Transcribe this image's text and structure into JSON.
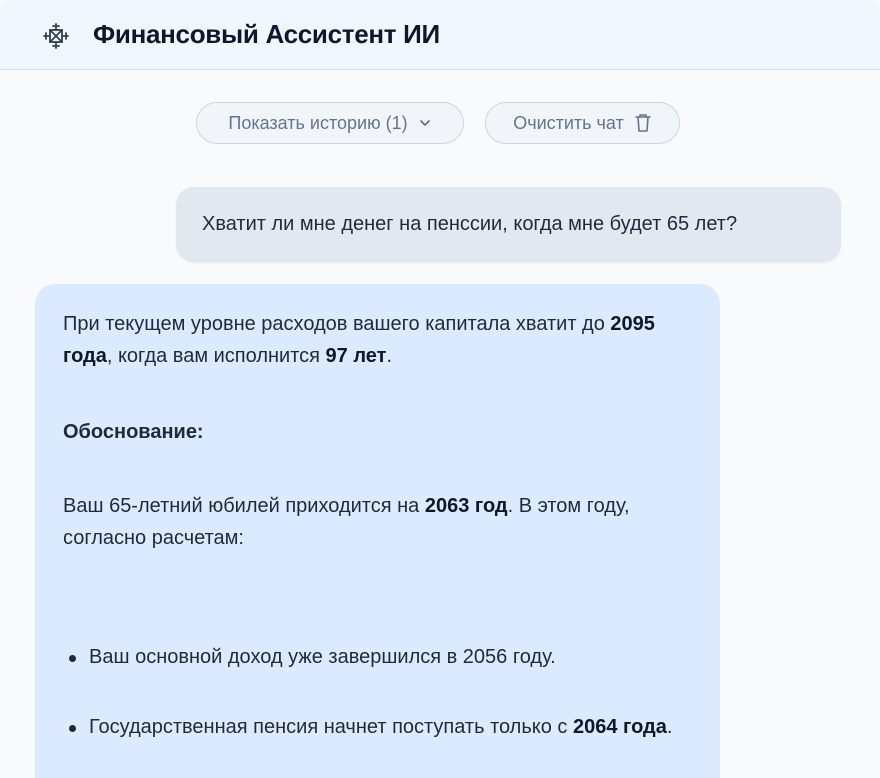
{
  "header": {
    "title": "Финансовый Ассистент ИИ",
    "logo_icon": "network-icon"
  },
  "toolbar": {
    "history_label": "Показать историю (1)",
    "history_icon": "chevron-down-icon",
    "clear_label": "Очистить чат",
    "clear_icon": "trash-icon"
  },
  "messages": {
    "user": {
      "text": "Хватит ли мне денег на пенссии, когда мне будет 65 лет?"
    },
    "assistant": {
      "p1_a": "При текущем уровне расходов вашего капитала хватит до ",
      "p1_b": "2095 года",
      "p1_c": ", когда вам исполнится ",
      "p1_d": "97 лет",
      "p1_e": ".",
      "heading": "Обоснование:",
      "p3_a": "Ваш 65-летний юбилей приходится на ",
      "p3_b": "2063 год",
      "p3_c": ". В этом году, согласно расчетам:",
      "bullet1": "Ваш основной доход уже завершился в 2056 году.",
      "bullet2_a": "Государственная пенсия начнет поступать только с ",
      "bullet2_b": "2064 года",
      "bullet2_c": "."
    }
  },
  "colors": {
    "header_bg": "#f0f7ff",
    "user_bubble": "#e2e8f0",
    "assistant_bubble": "#dbeafe",
    "text": "#1e293b"
  }
}
